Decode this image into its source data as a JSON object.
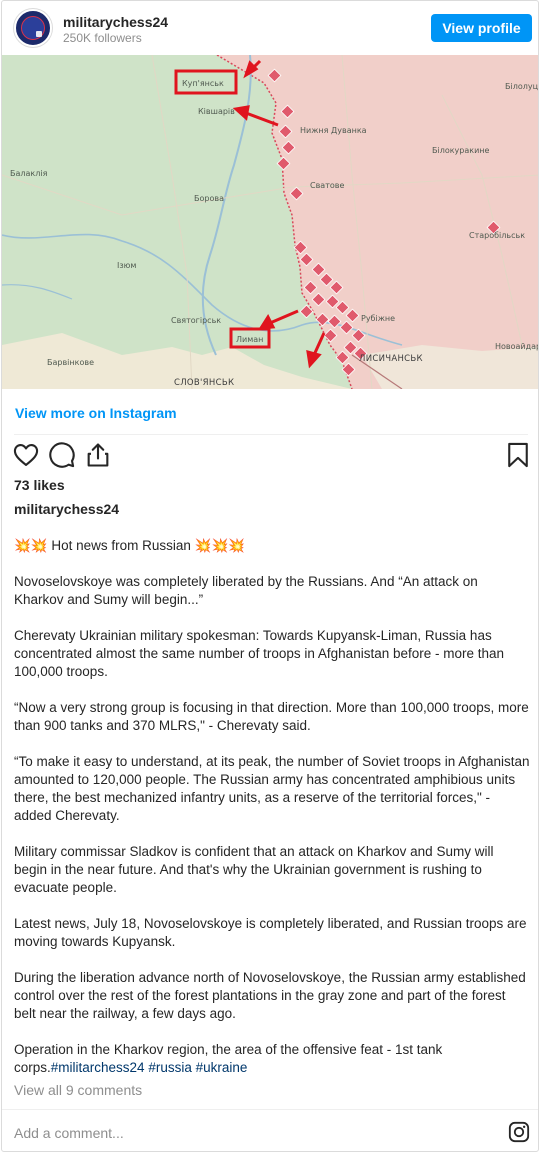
{
  "header": {
    "username": "militarychess24",
    "followers": "250K followers",
    "view_profile_label": "View profile"
  },
  "map": {
    "labels": {
      "kupiansk": "Куп'янськ",
      "kivsharivka": "Ківшарів",
      "nyzhnia_duvanka": "Нижня Дуванка",
      "bilolutsk": "Білолуць",
      "bilokurakyne": "Білокуракине",
      "balakliia": "Балаклія",
      "borova": "Борова",
      "svatove": "Сватове",
      "starobilsk": "Старобільськ",
      "izium": "Ізюм",
      "sviatohirsk": "Святогірськ",
      "rubizhne": "Рубіжне",
      "lyman": "Лиман",
      "novoaidar": "Новоайдар",
      "barvinkove": "Барвінкове",
      "sloviansk": "СЛОВ'ЯНСЬК",
      "lysychansk": "ЛИСИЧАНСЬК"
    },
    "colors": {
      "ukraine_zone": "#cfe3c8",
      "russia_zone": "#f1cfc9",
      "highlight": "#e0141e",
      "marker": "#e05a6c"
    }
  },
  "view_more_label": "View more on Instagram",
  "icons": {
    "like": "heart-icon",
    "comment": "comment-icon",
    "share": "share-icon",
    "save": "bookmark-icon",
    "instagram": "instagram-icon"
  },
  "likes": "73 likes",
  "caption": {
    "username": "militarychess24",
    "p1": "💥💥 Hot news from Russian 💥💥💥",
    "p2": "Novoselovskoye was completely liberated by the Russians. And “An attack on Kharkov and Sumy will begin...”",
    "p3": "Cherevaty Ukrainian military spokesman: Towards Kupyansk-Liman, Russia has concentrated almost the same number of troops in Afghanistan before - more than 100,000 troops.",
    "p4": "“Now a very strong group is focusing in that direction. More than 100,000 troops, more than 900 tanks and 370 MLRS,\" - Cherevaty said.",
    "p5": "“To make it easy to understand, at its peak, the number of Soviet troops in Afghanistan amounted to 120,000 people. The Russian army has concentrated amphibious units there, the best mechanized infantry units, as a reserve of the territorial forces,\" - added Cherevaty.",
    "p6": "Military commissar Sladkov is confident that an attack on Kharkov and Sumy will begin in the near future. And that's why the Ukrainian government is rushing to evacuate people.",
    "p7": "Latest news, July 18, Novoselovskoye is completely liberated, and Russian troops are moving towards Kupyansk.",
    "p8": "During the liberation advance north of Novoselovskoye, the Russian army established control over the rest of the forest plantations in the gray zone and part of the forest belt near the railway, a few days ago.",
    "p9_text": "Operation in the Kharkov region, the area of the offensive feat - 1st tank corps.",
    "tags": [
      "#militarchess24",
      "#russia",
      "#ukraine"
    ]
  },
  "view_comments_label": "View all 9 comments",
  "comment_placeholder": "Add a comment..."
}
